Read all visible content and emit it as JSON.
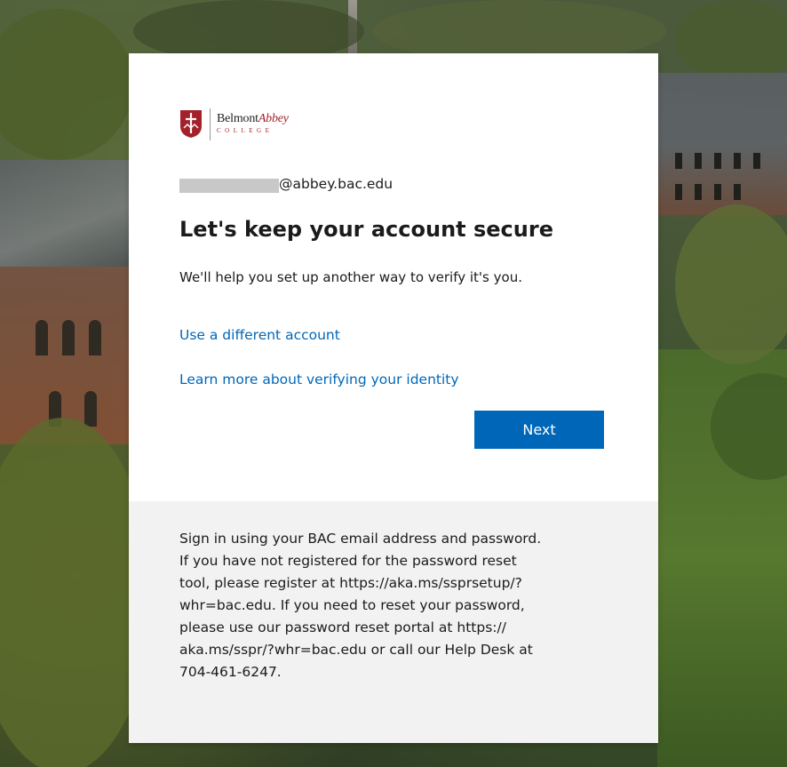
{
  "brand": {
    "name_plain": "Belmont",
    "name_script": "Abbey",
    "subtitle": "COLLEGE",
    "accent_color": "#a3212b"
  },
  "account": {
    "email_suffix": "@abbey.bac.edu"
  },
  "heading": {
    "title": "Let's keep your account secure",
    "subtitle": "We'll help you set up another way to verify it's you."
  },
  "links": {
    "different_account": "Use a different account",
    "learn_more": "Learn more about verifying your identity"
  },
  "actions": {
    "next_label": "Next",
    "primary_color": "#0067b8"
  },
  "footer": {
    "info_lines": "Sign in using your BAC email address and password.\nIf you have not registered for the password reset\ntool, please register at https://aka.ms/ssprsetup/?\nwhr=bac.edu. If you need to reset your password,\nplease use our password reset portal at https://\naka.ms/sspr/?whr=bac.edu or call our Help Desk at\n704-461-6247."
  }
}
